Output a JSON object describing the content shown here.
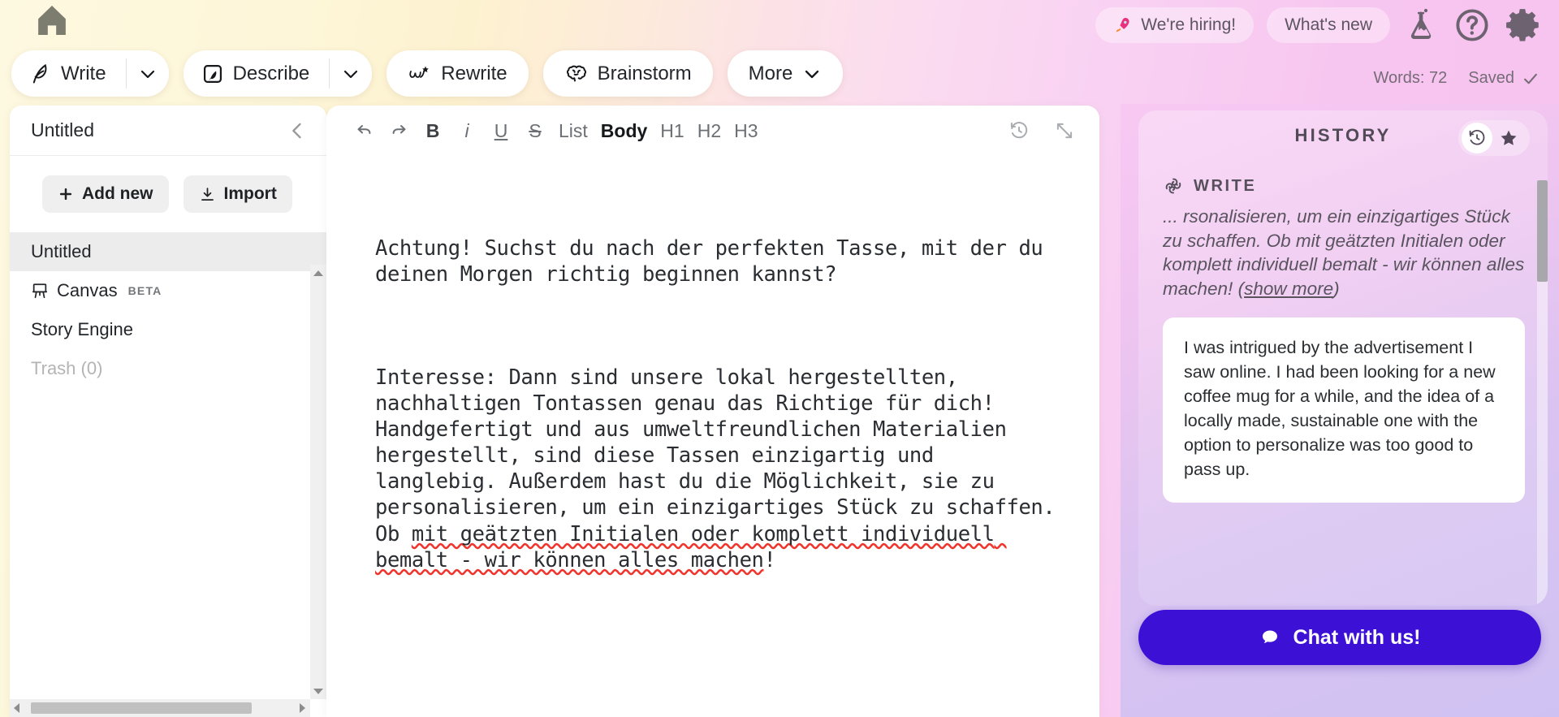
{
  "header": {
    "home_icon": "home-icon",
    "tools": [
      {
        "label": "Write",
        "icon": "feather-pen-icon",
        "has_caret": true
      },
      {
        "label": "Describe",
        "icon": "image-pen-icon",
        "has_caret": true
      },
      {
        "label": "Rewrite",
        "icon": "cursive-star-icon",
        "has_caret": false
      },
      {
        "label": "Brainstorm",
        "icon": "brain-icon",
        "has_caret": false
      }
    ],
    "more_label": "More",
    "hiring_chip": "We're hiring!",
    "hiring_icon": "rocket-icon",
    "whats_new_chip": "What's new",
    "icons": [
      "lab-flask-icon",
      "help-circle-icon",
      "gear-icon"
    ],
    "word_count": "Words: 72",
    "saved_label": "Saved"
  },
  "sidebar": {
    "title": "Untitled",
    "collapse_icon": "chevron-left-icon",
    "add_new_label": "Add new",
    "import_label": "Import",
    "items": [
      {
        "label": "Untitled",
        "active": true,
        "icon": null,
        "badge": null,
        "muted": false
      },
      {
        "label": "Canvas",
        "active": false,
        "icon": "easel-icon",
        "badge": "BETA",
        "muted": false
      },
      {
        "label": "Story Engine",
        "active": false,
        "icon": null,
        "badge": null,
        "muted": false
      },
      {
        "label": "Trash (0)",
        "active": false,
        "icon": null,
        "badge": null,
        "muted": true
      }
    ]
  },
  "editor": {
    "toolbar": {
      "undo": "↶",
      "redo": "↷",
      "bold": "B",
      "italic": "i",
      "underline": "U",
      "strike": "S",
      "list": "List",
      "body": "Body",
      "h1": "H1",
      "h2": "H2",
      "h3": "H3",
      "history_icon": "history-clock-icon",
      "expand_icon": "expand-diagonal-icon"
    },
    "paragraph_1": "Achtung! Suchst du nach der perfekten Tasse, mit der du deinen Morgen richtig beginnen kannst?",
    "paragraph_2_plain": "Interesse: Dann sind unsere lokal hergestellten, nachhaltigen Tontassen genau das Richtige für dich! Handgefertigt und aus umweltfreundlichen Materialien hergestellt, sind diese Tassen einzigartig und langlebig. Außerdem hast du die Möglichkeit, sie zu personalisieren, um ein einzigartiges Stück zu schaffen. Ob ",
    "paragraph_2_spellchecked": "mit geätzten Initialen oder komplett individuell bemalt - wir können alles machen",
    "paragraph_2_tail": "!"
  },
  "history": {
    "title": "HISTORY",
    "toggle": {
      "history_icon": "history-clock-icon",
      "favorites_icon": "star-icon"
    },
    "entry": {
      "icon": "spiral-icon",
      "label": "WRITE",
      "snippet": "... rsonalisieren, um ein einzigartiges Stück zu schaffen. Ob mit geätzten Initialen oder komplett individuell bemalt - wir können alles machen!",
      "show_more": "show more",
      "card_text": "I was intrigued by the advertisement I saw online. I had been looking for a new coffee mug for a while, and the idea of a locally made, sustainable one with the option to personalize was too good to pass up."
    },
    "chat_button": {
      "label": "Chat with us!",
      "icon": "chat-bubble-icon"
    }
  },
  "colors": {
    "accent_purple": "#3d10d6",
    "spellcheck_red": "#f0342c",
    "sidebar_active": "#ececec"
  }
}
